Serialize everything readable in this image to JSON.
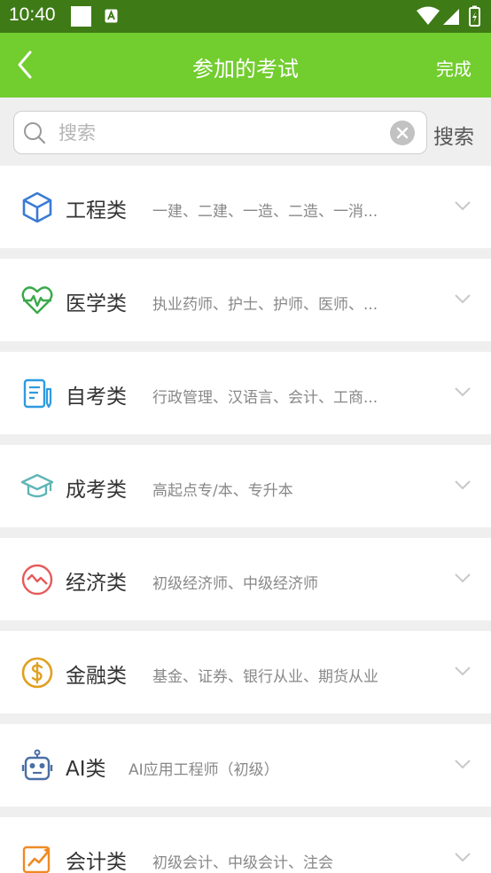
{
  "status_bar": {
    "time": "10:40"
  },
  "header": {
    "title": "参加的考试",
    "done_label": "完成"
  },
  "search": {
    "placeholder": "搜索",
    "value": "",
    "button_label": "搜索"
  },
  "categories": [
    {
      "name": "工程类",
      "desc": "一建、二建、一造、二造、一消...",
      "icon": "cube-icon",
      "color": "#3a7bd5"
    },
    {
      "name": "医学类",
      "desc": "执业药师、护士、护师、医师、...",
      "icon": "heart-pulse-icon",
      "color": "#3aa84a"
    },
    {
      "name": "自考类",
      "desc": "行政管理、汉语言、会计、工商...",
      "icon": "notebook-pen-icon",
      "color": "#2e9be0"
    },
    {
      "name": "成考类",
      "desc": "高起点专/本、专升本",
      "icon": "graduation-cap-icon",
      "color": "#5fb5b5"
    },
    {
      "name": "经济类",
      "desc": "初级经济师、中级经济师",
      "icon": "trend-circle-icon",
      "color": "#e65a5a"
    },
    {
      "name": "金融类",
      "desc": "基金、证券、银行从业、期货从业",
      "icon": "dollar-coin-icon",
      "color": "#e0a020"
    },
    {
      "name": "AI类",
      "desc": "AI应用工程师（初级）",
      "icon": "robot-icon",
      "color": "#4a6fa5"
    },
    {
      "name": "会计类",
      "desc": "初级会计、中级会计、注会",
      "icon": "growth-chart-icon",
      "color": "#f08a24"
    }
  ]
}
